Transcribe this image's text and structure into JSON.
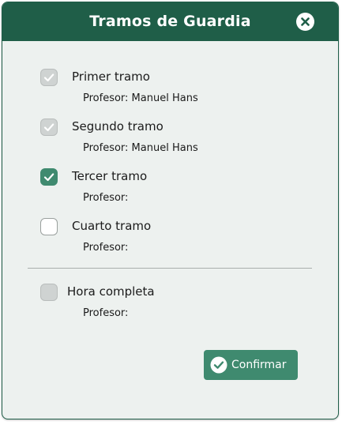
{
  "dialog": {
    "title": "Tramos de Guardia"
  },
  "options": [
    {
      "label": "Primer tramo",
      "profesor": "Profesor: Manuel Hans",
      "state": "checked-disabled"
    },
    {
      "label": "Segundo tramo",
      "profesor": "Profesor: Manuel Hans",
      "state": "checked-disabled"
    },
    {
      "label": "Tercer tramo",
      "profesor": "Profesor:",
      "state": "checked"
    },
    {
      "label": "Cuarto tramo",
      "profesor": "Profesor:",
      "state": "unchecked"
    }
  ],
  "full_hour": {
    "label": "Hora completa",
    "profesor": "Profesor:",
    "state": "disabled"
  },
  "actions": {
    "confirm_label": "Confirmar"
  },
  "colors": {
    "primary": "#1f5e48",
    "accent": "#3f8a6f",
    "background": "#edf1ef"
  },
  "icons": {
    "close": "close-circle-icon",
    "check": "checkmark-icon",
    "confirm": "check-circle-icon"
  }
}
